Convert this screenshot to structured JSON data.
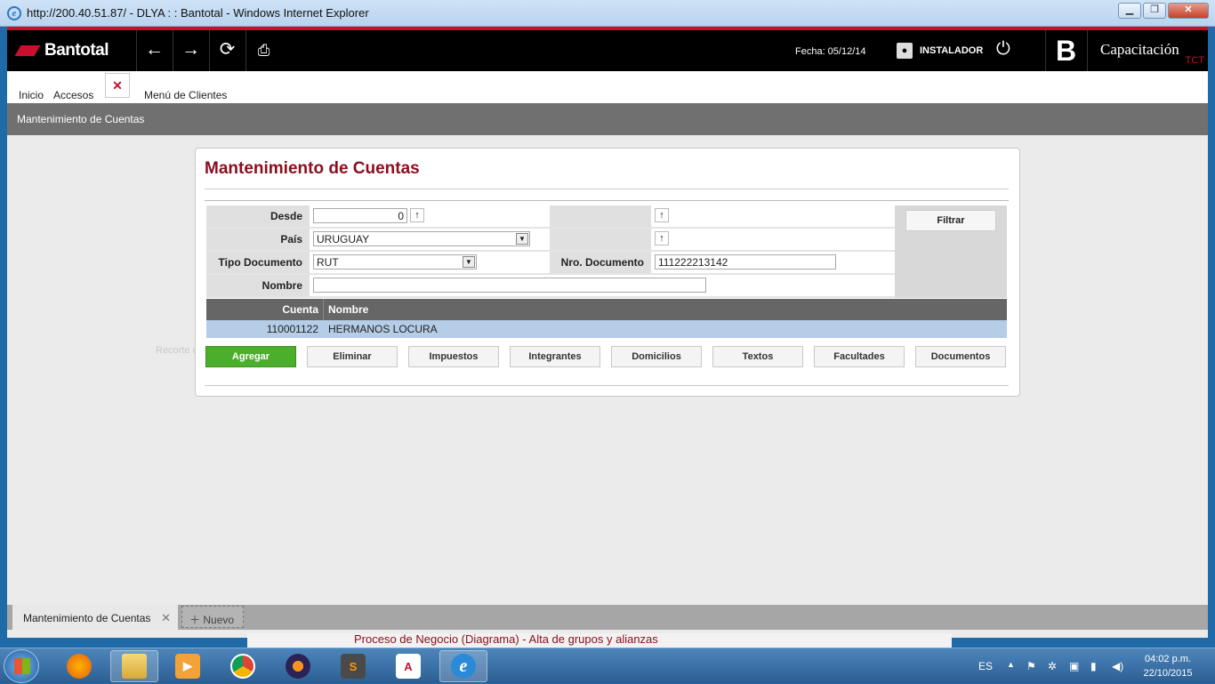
{
  "window": {
    "title": "http://200.40.51.87/ - DLYA : : Bantotal - Windows Internet Explorer"
  },
  "header": {
    "brand": "Bantotal",
    "fecha": "Fecha: 05/12/14",
    "user": "INSTALADOR",
    "env": "Capacitación",
    "env_tag": "TCT"
  },
  "menu": {
    "items": [
      "Inicio",
      "Accesos"
    ],
    "active": "Menú de Clientes"
  },
  "breadcrumb": "Mantenimiento de Cuentas",
  "form": {
    "title": "Mantenimiento de Cuentas",
    "desde_label": "Desde",
    "desde_value": "0",
    "pais_label": "País",
    "pais_value": "URUGUAY",
    "tipo_label": "Tipo Documento",
    "tipo_value": "RUT",
    "nrodoc_label": "Nro. Documento",
    "nrodoc_value": "111222213142",
    "nombre_label": "Nombre",
    "nombre_value": "",
    "filtrar": "Filtrar"
  },
  "table": {
    "headers": [
      "Cuenta",
      "Nombre"
    ],
    "rows": [
      [
        "110001122",
        "HERMANOS LOCURA"
      ]
    ]
  },
  "actions": [
    "Agregar",
    "Eliminar",
    "Impuestos",
    "Integrantes",
    "Domicilios",
    "Textos",
    "Facultades",
    "Documentos"
  ],
  "ghost_text": "Recorte de pantalla",
  "bottom_tabs": {
    "active": "Mantenimiento de Cuentas",
    "new": "Nuevo"
  },
  "behind_window": "Proceso de Negocio (Diagrama) - Alta de grupos y alianzas",
  "taskbar": {
    "lang": "ES",
    "time": "04:02 p.m.",
    "date": "22/10/2015"
  },
  "colors": {
    "brand_red": "#c8102e",
    "title_red": "#8b0e1d",
    "agregar_green": "#4caf2b"
  }
}
